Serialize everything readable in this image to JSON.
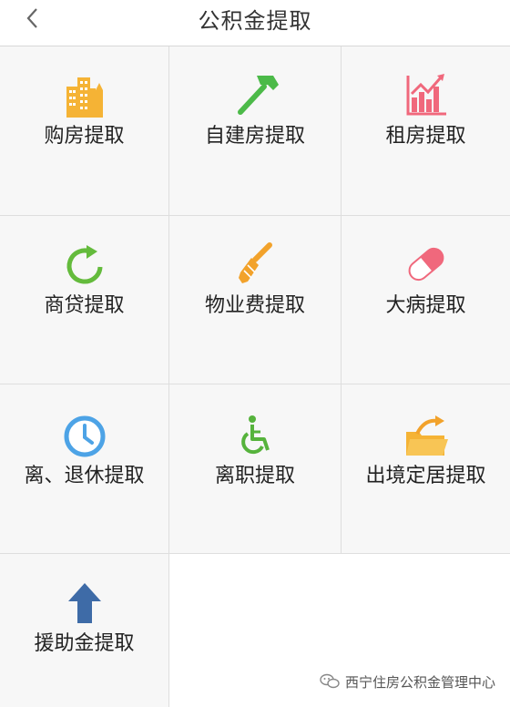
{
  "header": {
    "back_icon": "chevron-left-icon",
    "title": "公积金提取"
  },
  "items": [
    {
      "label": "购房提取",
      "icon": "buildings-icon",
      "color": "#f5b335"
    },
    {
      "label": "自建房提取",
      "icon": "hammer-icon",
      "color": "#4cba49"
    },
    {
      "label": "租房提取",
      "icon": "growth-chart-icon",
      "color": "#f0687c"
    },
    {
      "label": "商贷提取",
      "icon": "refresh-icon",
      "color": "#64bb3c"
    },
    {
      "label": "物业费提取",
      "icon": "screwdriver-icon",
      "color": "#f2a22b"
    },
    {
      "label": "大病提取",
      "icon": "pill-icon",
      "color": "#f0687c"
    },
    {
      "label": "离、退休提取",
      "icon": "clock-icon",
      "color": "#4da3e6"
    },
    {
      "label": "离职提取",
      "icon": "wheelchair-icon",
      "color": "#56b33c"
    },
    {
      "label": "出境定居提取",
      "icon": "folder-icon",
      "color": "#f5b335"
    },
    {
      "label": "援助金提取",
      "icon": "arrow-up-icon",
      "color": "#3e6ba7"
    }
  ],
  "watermark": {
    "text": "西宁住房公积金管理中心",
    "icon": "wechat-icon"
  }
}
